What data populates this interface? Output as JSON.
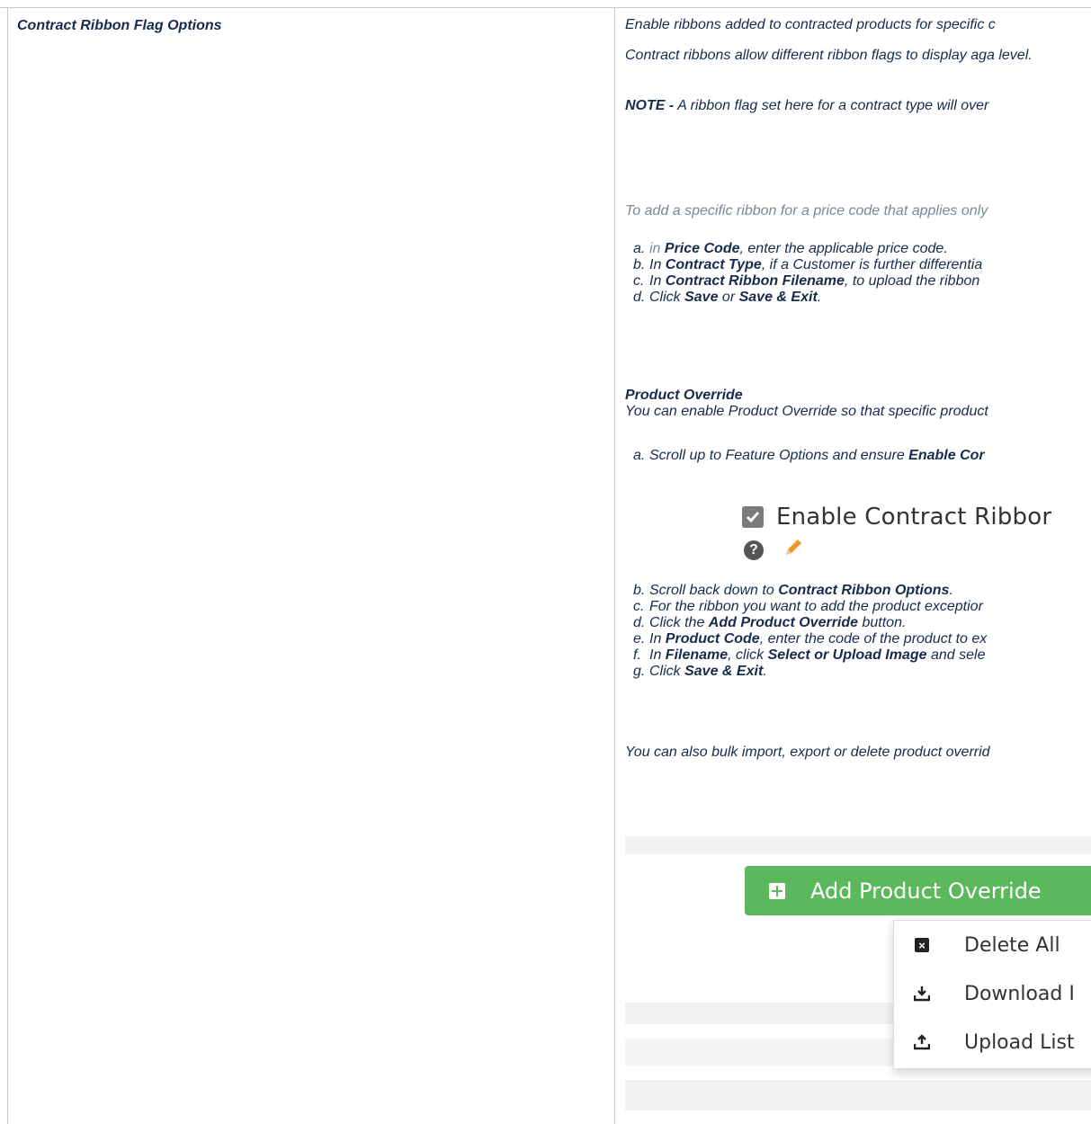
{
  "left_cell": {
    "title": "Contract Ribbon Flag Options"
  },
  "intro": {
    "p1": "Enable ribbons added to contracted products for specific c",
    "p2": "Contract ribbons allow different ribbon flags to display aga level.",
    "note_label": "NOTE -",
    "note_text": " A ribbon flag set here for a contract type will over"
  },
  "price_code_section": {
    "lead": "To add a specific ribbon for a price code that applies only",
    "steps": [
      {
        "label": "a.",
        "pre_muted": "in ",
        "bold": "Price Code",
        "rest": ", enter the applicable price code."
      },
      {
        "label": "b.",
        "pre": "In ",
        "bold": "Contract Type",
        "rest": ", if a Customer is further differentia"
      },
      {
        "label": "c.",
        "pre": "In ",
        "bold": "Contract Ribbon Filename",
        "rest": ", to upload the ribbon"
      },
      {
        "label": "d.",
        "pre": "Click ",
        "bold": "Save",
        "mid": " or ",
        "bold2": "Save & Exit",
        "rest": "."
      }
    ]
  },
  "product_override": {
    "heading": "Product Override",
    "intro": "You can enable Product Override so that specific product",
    "step_a": {
      "label": "a.",
      "pre": "Scroll up to Feature Options and ensure ",
      "bold": "Enable Cor"
    },
    "screenshot_label": "Enable Contract Ribbor",
    "steps": [
      {
        "label": "b.",
        "pre": "Scroll back down to ",
        "bold": "Contract Ribbon Options",
        "rest": "."
      },
      {
        "label": "c.",
        "pre": "For the ribbon you want to add the product exceptior"
      },
      {
        "label": "d.",
        "pre": "Click the ",
        "bold": "Add Product Override",
        "rest": " button."
      },
      {
        "label": "e.",
        "pre": "In ",
        "bold": "Product Code",
        "rest": ", enter the code of the product to ex"
      },
      {
        "label": "f.",
        "pre": "In ",
        "bold": "Filename",
        "mid": ", click ",
        "bold2": "Select or Upload Image",
        "rest": " and sele"
      },
      {
        "label": "g.",
        "pre": "Click ",
        "bold": "Save & Exit",
        "rest": "."
      }
    ],
    "bulk_text": "You can also bulk import, export or delete product overrid"
  },
  "screenshot2": {
    "button_label": "Add Product Override",
    "menu": [
      "Delete All",
      "Download I",
      "Upload List"
    ],
    "colors": {
      "button_bg": "#5cb85c"
    }
  }
}
